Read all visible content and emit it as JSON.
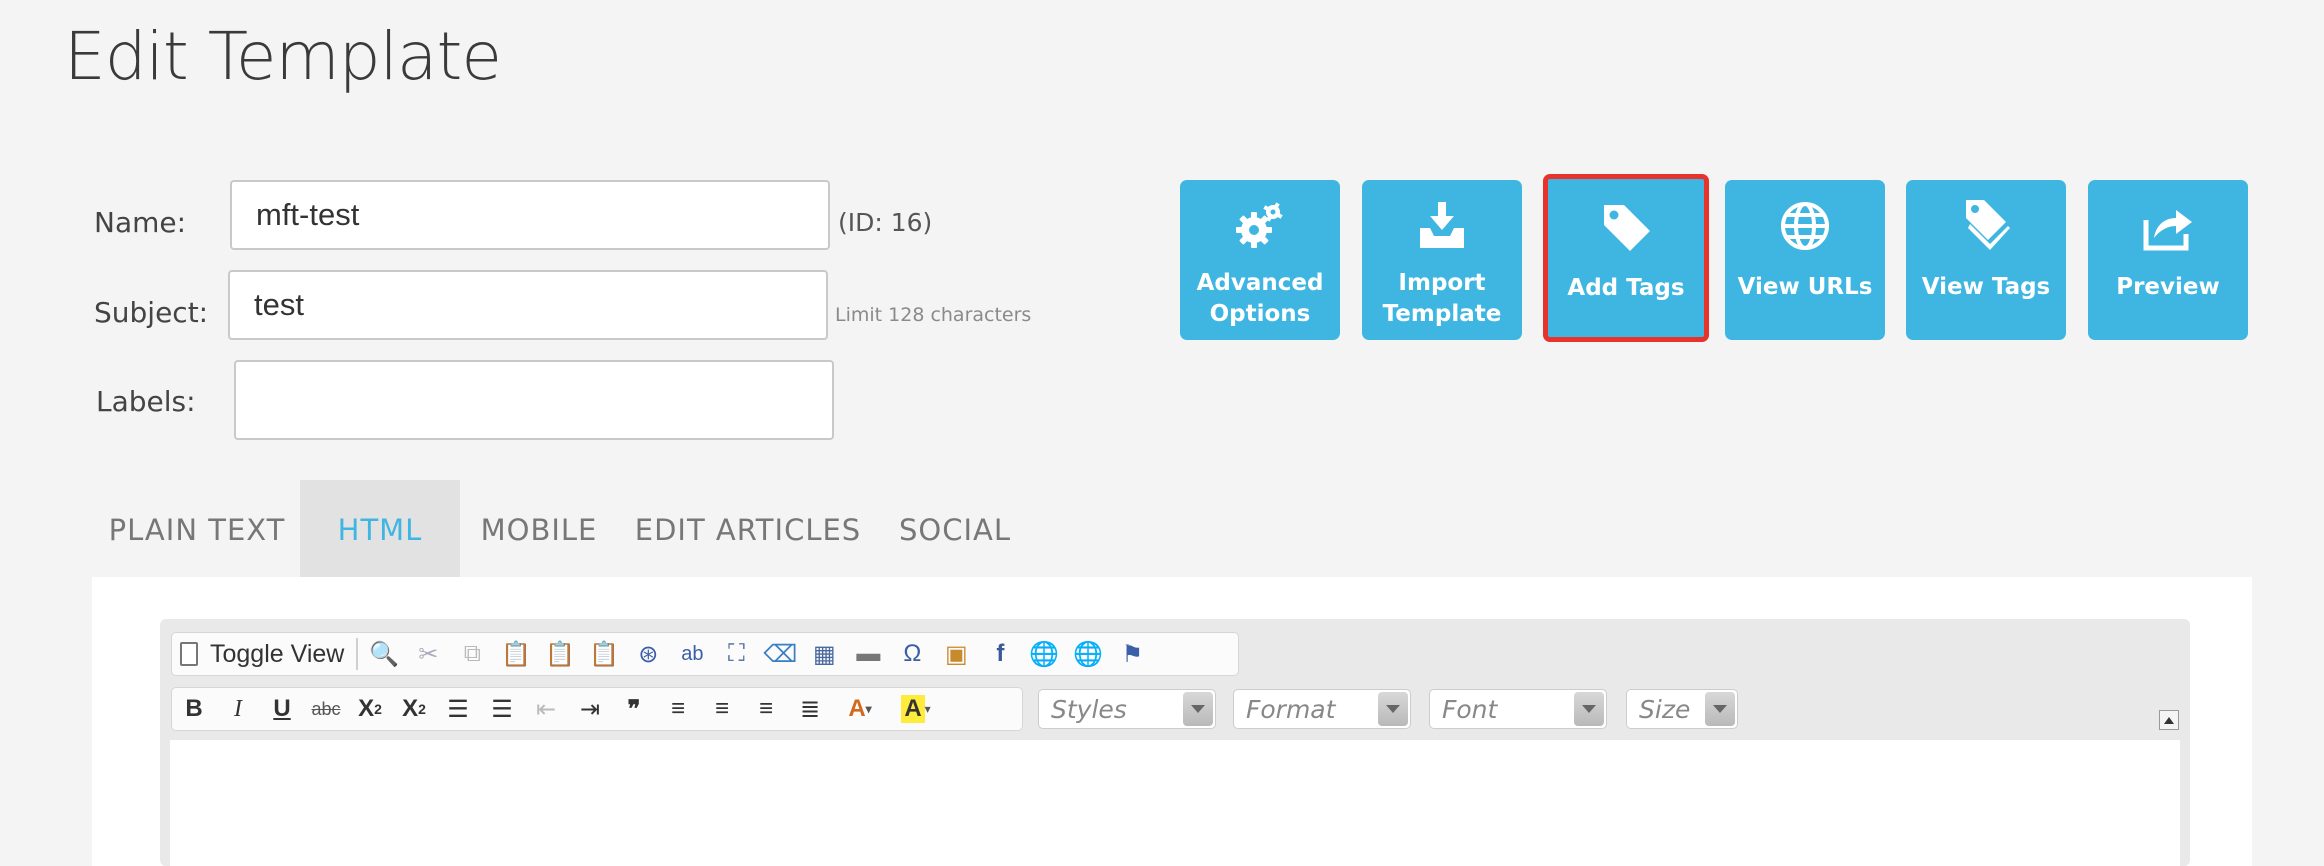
{
  "page": {
    "title": "Edit Template"
  },
  "form": {
    "name_label": "Name:",
    "name_value": "mft-test",
    "id_text": "(ID: 16)",
    "subject_label": "Subject:",
    "subject_value": "test",
    "subject_hint": "Limit 128 characters",
    "labels_label": "Labels:",
    "labels_value": ""
  },
  "actions": [
    {
      "line1": "Advanced",
      "line2": "Options",
      "icon": "gears-icon"
    },
    {
      "line1": "Import",
      "line2": "Template",
      "icon": "download-tray-icon"
    },
    {
      "line1": "Add Tags",
      "line2": "",
      "icon": "tag-icon",
      "highlighted": true
    },
    {
      "line1": "View URLs",
      "line2": "",
      "icon": "globe-icon"
    },
    {
      "line1": "View Tags",
      "line2": "",
      "icon": "tags-icon"
    },
    {
      "line1": "Preview",
      "line2": "",
      "icon": "share-icon"
    }
  ],
  "tabs": [
    {
      "label": "PLAIN TEXT",
      "active": false
    },
    {
      "label": "HTML",
      "active": true
    },
    {
      "label": "MOBILE",
      "active": false
    },
    {
      "label": "EDIT ARTICLES",
      "active": false
    },
    {
      "label": "SOCIAL",
      "active": false
    }
  ],
  "editor": {
    "toggle_view_label": "Toggle View",
    "styles_label": "Styles",
    "format_label": "Format",
    "font_label": "Font",
    "size_label": "Size"
  },
  "colors": {
    "accent": "#3fb6e1",
    "highlight": "#e8322c",
    "background": "#f4f4f4"
  }
}
